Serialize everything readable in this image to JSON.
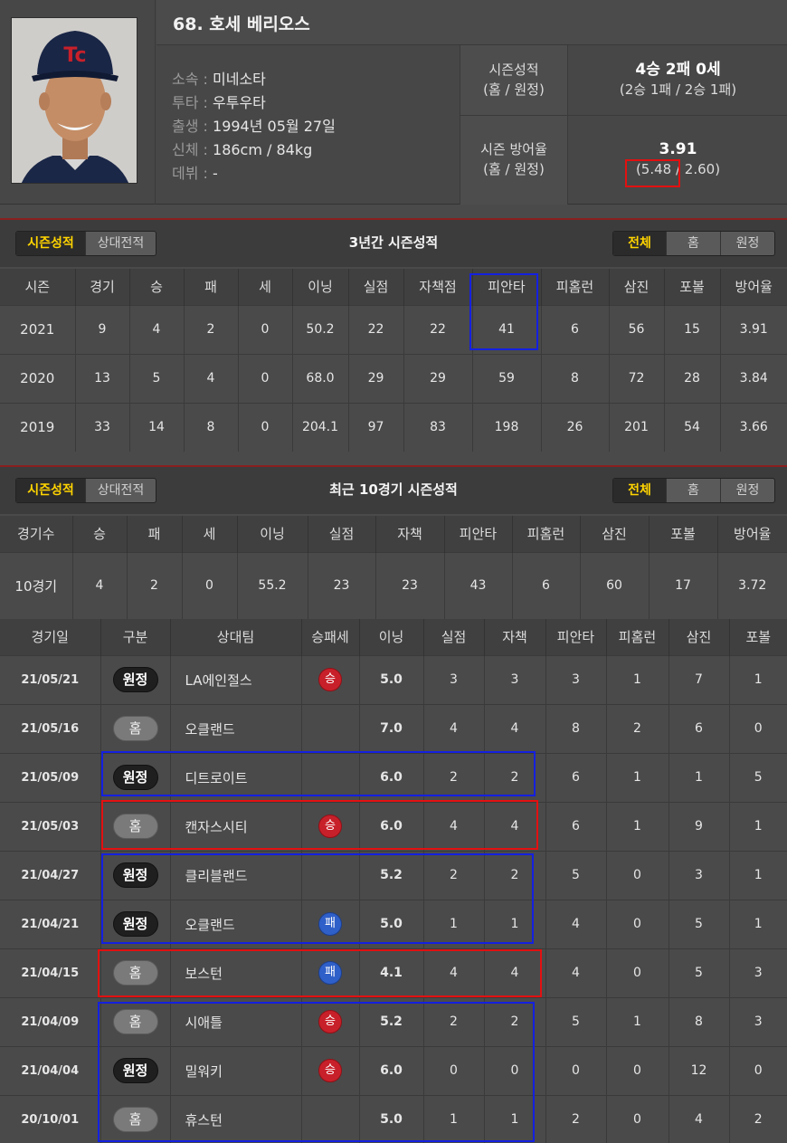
{
  "player": {
    "name": "68. 호세 베리오스",
    "team_label": "소속 : ",
    "team": "미네소타",
    "throwbat_label": "투타 : ",
    "throwbat": "우투우타",
    "birth_label": "출생 : ",
    "birth": "1994년 05월 27일",
    "body_label": "신체 : ",
    "body": "186cm / 84kg",
    "debut_label": "데뷔 : ",
    "debut": "-"
  },
  "season_record": {
    "label1": "시즌성적",
    "label2": "(홈 / 원정)",
    "total": "4승 2패 0세",
    "split": "(2승 1패 / 2승 1패)"
  },
  "season_era": {
    "label1": "시즌 방어율",
    "label2": "(홈 / 원정)",
    "total": "3.91",
    "split": "(5.48 / 2.60)"
  },
  "tabs": {
    "season": "시즌성적",
    "versus": "상대전적"
  },
  "filters": {
    "all": "전체",
    "home": "홈",
    "away": "원정"
  },
  "three_year": {
    "title": "3년간 시즌성적",
    "headers": [
      "시즌",
      "경기",
      "승",
      "패",
      "세",
      "이닝",
      "실점",
      "자책점",
      "피안타",
      "피홈런",
      "삼진",
      "포볼",
      "방어율"
    ],
    "rows": [
      [
        "2021",
        "9",
        "4",
        "2",
        "0",
        "50.2",
        "22",
        "22",
        "41",
        "6",
        "56",
        "15",
        "3.91"
      ],
      [
        "2020",
        "13",
        "5",
        "4",
        "0",
        "68.0",
        "29",
        "29",
        "59",
        "8",
        "72",
        "28",
        "3.84"
      ],
      [
        "2019",
        "33",
        "14",
        "8",
        "0",
        "204.1",
        "97",
        "83",
        "198",
        "26",
        "201",
        "54",
        "3.66"
      ]
    ]
  },
  "recent10": {
    "title": "최근 10경기 시즌성적",
    "headers": [
      "경기수",
      "승",
      "패",
      "세",
      "이닝",
      "실점",
      "자책",
      "피안타",
      "피홈런",
      "삼진",
      "포볼",
      "방어율"
    ],
    "row": [
      "10경기",
      "4",
      "2",
      "0",
      "55.2",
      "23",
      "23",
      "43",
      "6",
      "60",
      "17",
      "3.72"
    ]
  },
  "games": {
    "headers": [
      "경기일",
      "구분",
      "상대팀",
      "승패세",
      "이닝",
      "실점",
      "자책",
      "피안타",
      "피홈런",
      "삼진",
      "포볼"
    ],
    "rows": [
      {
        "date": "21/05/21",
        "venue": "원정",
        "type": "away",
        "opp": "LA에인절스",
        "dec": "승",
        "dtype": "win",
        "inn": "5.0",
        "r": "3",
        "er": "3",
        "h": "3",
        "hr": "1",
        "so": "7",
        "bb": "1"
      },
      {
        "date": "21/05/16",
        "venue": "홈",
        "type": "home",
        "opp": "오클랜드",
        "dec": "",
        "dtype": "",
        "inn": "7.0",
        "r": "4",
        "er": "4",
        "h": "8",
        "hr": "2",
        "so": "6",
        "bb": "0"
      },
      {
        "date": "21/05/09",
        "venue": "원정",
        "type": "away",
        "opp": "디트로이트",
        "dec": "",
        "dtype": "",
        "inn": "6.0",
        "r": "2",
        "er": "2",
        "h": "6",
        "hr": "1",
        "so": "1",
        "bb": "5"
      },
      {
        "date": "21/05/03",
        "venue": "홈",
        "type": "home",
        "opp": "캔자스시티",
        "dec": "승",
        "dtype": "win",
        "inn": "6.0",
        "r": "4",
        "er": "4",
        "h": "6",
        "hr": "1",
        "so": "9",
        "bb": "1"
      },
      {
        "date": "21/04/27",
        "venue": "원정",
        "type": "away",
        "opp": "클리블랜드",
        "dec": "",
        "dtype": "",
        "inn": "5.2",
        "r": "2",
        "er": "2",
        "h": "5",
        "hr": "0",
        "so": "3",
        "bb": "1"
      },
      {
        "date": "21/04/21",
        "venue": "원정",
        "type": "away",
        "opp": "오클랜드",
        "dec": "패",
        "dtype": "loss",
        "inn": "5.0",
        "r": "1",
        "er": "1",
        "h": "4",
        "hr": "0",
        "so": "5",
        "bb": "1"
      },
      {
        "date": "21/04/15",
        "venue": "홈",
        "type": "home",
        "opp": "보스턴",
        "dec": "패",
        "dtype": "loss",
        "inn": "4.1",
        "r": "4",
        "er": "4",
        "h": "4",
        "hr": "0",
        "so": "5",
        "bb": "3"
      },
      {
        "date": "21/04/09",
        "venue": "홈",
        "type": "home",
        "opp": "시애틀",
        "dec": "승",
        "dtype": "win",
        "inn": "5.2",
        "r": "2",
        "er": "2",
        "h": "5",
        "hr": "1",
        "so": "8",
        "bb": "3"
      },
      {
        "date": "21/04/04",
        "venue": "원정",
        "type": "away",
        "opp": "밀워키",
        "dec": "승",
        "dtype": "win",
        "inn": "6.0",
        "r": "0",
        "er": "0",
        "h": "0",
        "hr": "0",
        "so": "12",
        "bb": "0"
      },
      {
        "date": "20/10/01",
        "venue": "홈",
        "type": "home",
        "opp": "휴스턴",
        "dec": "",
        "dtype": "",
        "inn": "5.0",
        "r": "1",
        "er": "1",
        "h": "2",
        "hr": "0",
        "so": "4",
        "bb": "2"
      }
    ]
  },
  "colors": {
    "filter_active": "#ffd400",
    "win": "#c8202a",
    "loss": "#2f5fc8",
    "highlight_red": "#e31010",
    "highlight_blue": "#1420e0"
  }
}
